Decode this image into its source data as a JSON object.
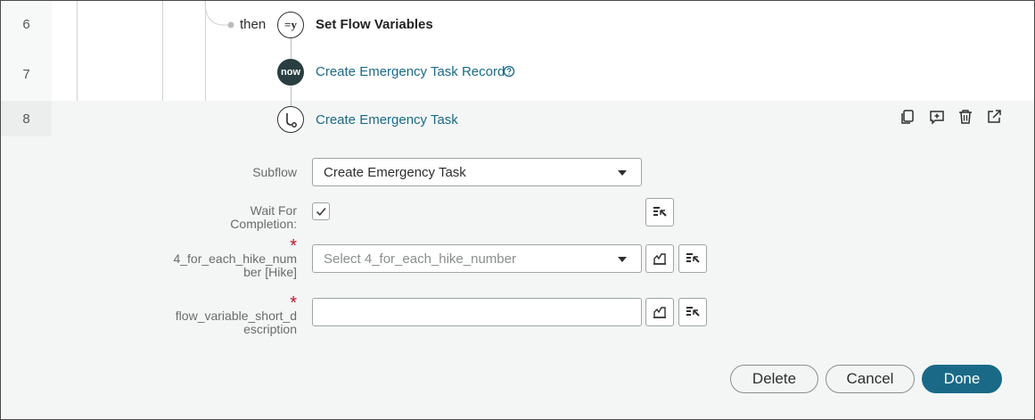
{
  "rows": [
    {
      "number": "6",
      "connector": "then",
      "icon": "set-variable-icon",
      "icon_text": "=y",
      "label": "Set Flow Variables"
    },
    {
      "number": "7",
      "icon": "now-logo-icon",
      "icon_text": "now",
      "label": "Create Emergency Task Record",
      "help_icon": "help-icon"
    },
    {
      "number": "8",
      "icon": "subflow-icon",
      "label": "Create Emergency Task"
    }
  ],
  "row_toolbar": [
    "copy-icon",
    "add-comment-icon",
    "delete-icon",
    "open-external-icon"
  ],
  "form": {
    "subflow": {
      "label": "Subflow",
      "value": "Create Emergency Task"
    },
    "wait": {
      "label_line1": "Wait For",
      "label_line2": "Completion:",
      "checked": true
    },
    "hike": {
      "required_mark": "*",
      "label_line1": "4_for_each_hike_num",
      "label_line2": "ber [Hike]",
      "placeholder": "Select 4_for_each_hike_number"
    },
    "short_desc": {
      "required_mark": "*",
      "label_line1": "flow_variable_short_d",
      "label_line2": "escription",
      "value": ""
    }
  },
  "buttons": {
    "delete": "Delete",
    "cancel": "Cancel",
    "done": "Done"
  },
  "colors": {
    "accent": "#1a6a87",
    "gutter": "#eceeee",
    "selected_bg": "#f4f6f6",
    "required": "#c8102e",
    "now_badge": "#293e40"
  }
}
